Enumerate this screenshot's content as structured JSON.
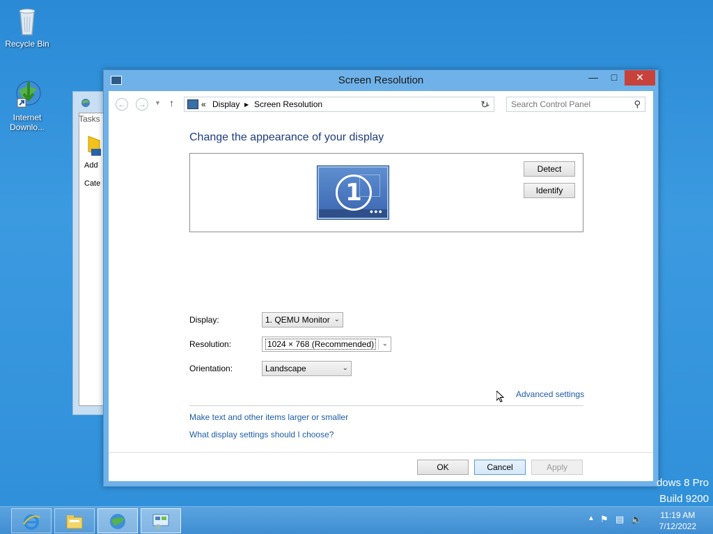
{
  "desktop": {
    "icons": [
      {
        "label": "Recycle Bin"
      },
      {
        "label": "Internet Downlo..."
      }
    ],
    "watermark": {
      "line1": "dows 8 Pro",
      "line2": "Build 9200"
    }
  },
  "background_window": {
    "tab": "Tasks",
    "add_label": "Add",
    "cate_label": "Cate"
  },
  "dialog": {
    "title": "Screen Resolution",
    "nav": {
      "crumb_prefix": "«",
      "crumb1": "Display",
      "crumb2": "Screen Resolution",
      "search_placeholder": "Search Control Panel"
    },
    "heading": "Change the appearance of your display",
    "monitor_number": "1",
    "detect_label": "Detect",
    "identify_label": "Identify",
    "fields": {
      "display_label": "Display:",
      "display_value": "1. QEMU Monitor",
      "resolution_label": "Resolution:",
      "resolution_value": "1024 × 768 (Recommended)",
      "orientation_label": "Orientation:",
      "orientation_value": "Landscape"
    },
    "advanced_link": "Advanced settings",
    "links": [
      "Make text and other items larger or smaller",
      "What display settings should I choose?"
    ],
    "buttons": {
      "ok": "OK",
      "cancel": "Cancel",
      "apply": "Apply"
    }
  },
  "taskbar": {
    "items": [
      {
        "icon": "internet-explorer-icon"
      },
      {
        "icon": "file-explorer-icon"
      },
      {
        "icon": "internet-download-manager-icon"
      },
      {
        "icon": "control-panel-icon"
      }
    ],
    "clock": {
      "time": "11:19 AM",
      "date": "7/12/2022"
    }
  },
  "colors": {
    "desktop_bg": "#2a8ad6",
    "window_frame": "#6fb2ea",
    "link": "#1d5ca8",
    "heading": "#1e3d7b",
    "close_button": "#c7423a"
  }
}
